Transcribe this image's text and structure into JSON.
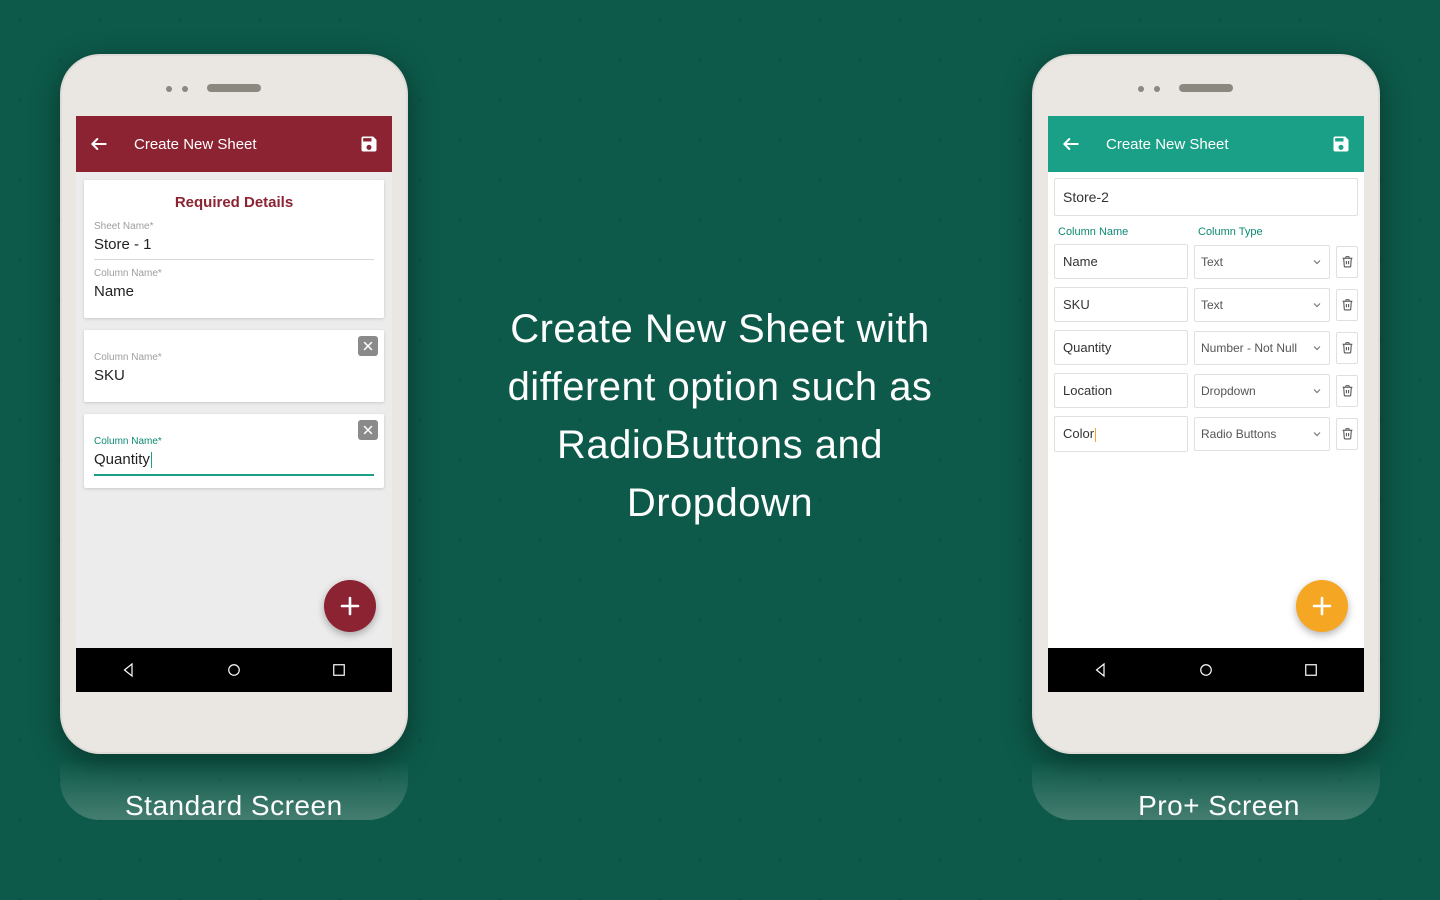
{
  "headline": "Create New Sheet with different option such as RadioButtons and Dropdown",
  "captions": {
    "left": "Standard Screen",
    "right": "Pro+ Screen"
  },
  "standard": {
    "appbar_title": "Create New Sheet",
    "card_heading": "Required Details",
    "sheet_name_label": "Sheet Name*",
    "sheet_name_value": "Store - 1",
    "column_name_label": "Column Name*",
    "columns": [
      {
        "label": "Column Name*",
        "value": "Name"
      },
      {
        "label": "Column Name*",
        "value": "SKU"
      },
      {
        "label": "Column Name*",
        "value": "Quantity",
        "active": true
      }
    ]
  },
  "pro": {
    "appbar_title": "Create New Sheet",
    "sheet_name_value": "Store-2",
    "header_col_name": "Column Name",
    "header_col_type": "Column Type",
    "rows": [
      {
        "name": "Name",
        "type": "Text"
      },
      {
        "name": "SKU",
        "type": "Text"
      },
      {
        "name": "Quantity",
        "type": "Number - Not Null"
      },
      {
        "name": "Location",
        "type": "Dropdown"
      },
      {
        "name": "Color",
        "type": "Radio Buttons",
        "active": true
      }
    ]
  },
  "icons": {
    "back": "back-arrow-icon",
    "save": "save-icon",
    "add": "plus-icon",
    "delete": "close-icon",
    "trash": "trash-icon",
    "chevron": "chevron-down-icon",
    "nav_back": "nav-back-icon",
    "nav_home": "nav-home-icon",
    "nav_recent": "nav-recent-icon"
  },
  "colors": {
    "maroon": "#8c2332",
    "teal": "#1aa087",
    "orange": "#f5a623",
    "green_bg": "#0d5a4a"
  }
}
